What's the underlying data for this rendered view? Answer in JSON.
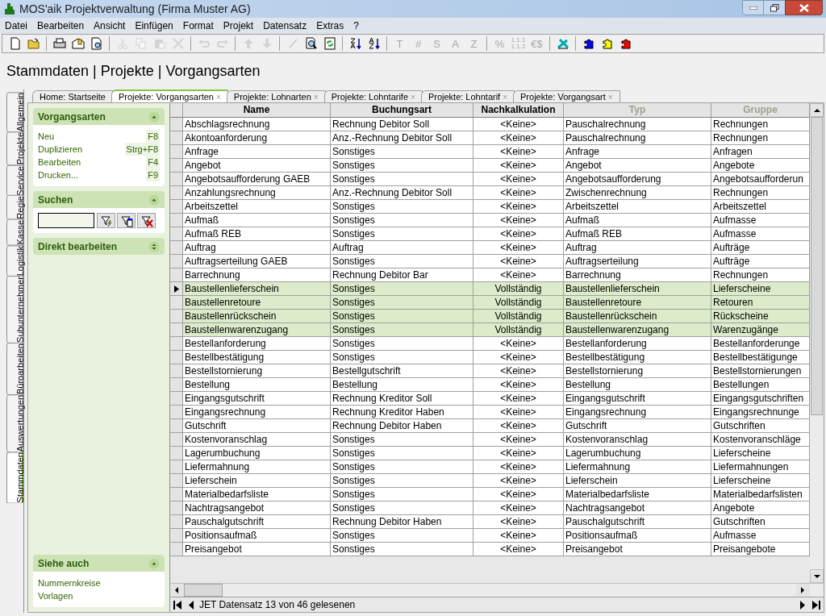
{
  "window": {
    "title": "MOS'aik Projektverwaltung (Firma Muster AG)"
  },
  "menu": [
    "Datei",
    "Bearbeiten",
    "Ansicht",
    "Einfügen",
    "Format",
    "Projekt",
    "Datensatz",
    "Extras",
    "?"
  ],
  "toolbar": [
    [
      {
        "kind": "page",
        "disabled": false
      },
      {
        "kind": "folder",
        "disabled": false
      }
    ],
    [
      {
        "kind": "printer",
        "disabled": false
      },
      {
        "kind": "mail",
        "disabled": false
      },
      {
        "kind": "preview",
        "disabled": false
      }
    ],
    [
      {
        "kind": "cut",
        "disabled": true
      },
      {
        "kind": "copy",
        "disabled": true
      },
      {
        "kind": "paste",
        "disabled": true
      },
      {
        "kind": "delete",
        "disabled": true
      }
    ],
    [
      {
        "kind": "undo",
        "disabled": true
      },
      {
        "kind": "redo",
        "disabled": true
      }
    ],
    [
      {
        "kind": "up",
        "disabled": true
      },
      {
        "kind": "down",
        "disabled": true
      }
    ],
    [
      {
        "kind": "pen",
        "disabled": true
      },
      {
        "kind": "find",
        "disabled": false
      },
      {
        "kind": "refresh",
        "disabled": false
      }
    ],
    [
      {
        "kind": "sort-asc",
        "disabled": false
      },
      {
        "kind": "sort-desc",
        "disabled": false
      }
    ],
    [
      {
        "kind": "text",
        "label": "T",
        "disabled": true
      },
      {
        "kind": "text",
        "label": "#",
        "disabled": true
      },
      {
        "kind": "text",
        "label": "S",
        "disabled": true
      },
      {
        "kind": "text",
        "label": "A",
        "disabled": true
      },
      {
        "kind": "text",
        "label": "Z",
        "disabled": true
      }
    ],
    [
      {
        "kind": "text",
        "label": "%",
        "disabled": true
      },
      {
        "kind": "stack",
        "label": "1.1.1",
        "label2": "1.1.2",
        "disabled": true
      },
      {
        "kind": "text",
        "label": "€$",
        "disabled": true
      }
    ],
    [
      {
        "kind": "tool",
        "disabled": false
      }
    ],
    [
      {
        "kind": "puzzle",
        "color": "#0000ff",
        "disabled": false
      },
      {
        "kind": "puzzle",
        "color": "#ffff00",
        "disabled": false
      },
      {
        "kind": "puzzle",
        "color": "#ff0000",
        "disabled": false
      }
    ]
  ],
  "heading": "Stammdaten | Projekte | Vorgangsarten",
  "side_tabs": [
    {
      "label": "Allgemein",
      "selected": false
    },
    {
      "label": "Projekte",
      "selected": false
    },
    {
      "label": "Service",
      "selected": false
    },
    {
      "label": "Regie",
      "selected": false
    },
    {
      "label": "Kasse",
      "selected": false
    },
    {
      "label": "Logistik",
      "selected": false
    },
    {
      "label": "Subunternehmer",
      "selected": false
    },
    {
      "label": "Büroarbeiten",
      "selected": false
    },
    {
      "label": "Auswertungen",
      "selected": false
    },
    {
      "label": "Stammdaten",
      "selected": true
    }
  ],
  "doc_tabs": [
    {
      "label": "Home: Startseite",
      "selected": false
    },
    {
      "label": "Projekte: Vorgangsarten",
      "close": "×",
      "selected": true
    },
    {
      "label": "Projekte: Lohnarten",
      "close": "×",
      "selected": false
    },
    {
      "label": "Projekte: Lohntarife",
      "close": "×",
      "selected": false
    },
    {
      "label": "Projekte: Lohntarif",
      "close": "×",
      "selected": false
    },
    {
      "label": "Projekte: Vorgangsart",
      "close": "×",
      "selected": false
    }
  ],
  "panel": {
    "sections": [
      {
        "kind": "actions",
        "title": "Vorgangsarten",
        "expanded": true,
        "items": [
          {
            "label": "Neu",
            "shortcut": "F8"
          },
          {
            "label": "Duplizieren",
            "shortcut": "Strg+F8"
          },
          {
            "label": "Bearbeiten",
            "shortcut": "F4"
          },
          {
            "label": "Drucken...",
            "shortcut": "F9"
          }
        ]
      },
      {
        "kind": "search",
        "title": "Suchen",
        "expanded": true
      },
      {
        "title": "Direkt bearbeiten",
        "expanded": false
      }
    ],
    "footer": {
      "kind": "links",
      "title": "Siehe auch",
      "expanded": true,
      "items": [
        {
          "label": "Nummernkreise"
        },
        {
          "label": "Vorlagen"
        }
      ]
    }
  },
  "table": {
    "columns": [
      {
        "label": "Name",
        "disabled": false
      },
      {
        "label": "Buchungsart",
        "disabled": false
      },
      {
        "label": "Nachkalkulation",
        "disabled": false
      },
      {
        "label": "Typ",
        "disabled": true
      },
      {
        "label": "Gruppe",
        "disabled": true
      }
    ],
    "rows": [
      {
        "cells": [
          "Abschlagsrechnung",
          "Rechnung Debitor Soll",
          "<Keine>",
          "Pauschalrechnung",
          "Rechnungen"
        ],
        "selected": false,
        "current": false
      },
      {
        "cells": [
          "Akontoanforderung",
          "Anz.-Rechnung Debitor Soll",
          "<Keine>",
          "Pauschalrechnung",
          "Rechnungen"
        ],
        "selected": false,
        "current": false
      },
      {
        "cells": [
          "Anfrage",
          "Sonstiges",
          "<Keine>",
          "Anfrage",
          "Anfragen"
        ],
        "selected": false,
        "current": false
      },
      {
        "cells": [
          "Angebot",
          "Sonstiges",
          "<Keine>",
          "Angebot",
          "Angebote"
        ],
        "selected": false,
        "current": false
      },
      {
        "cells": [
          "Angebotsaufforderung GAEB",
          "Sonstiges",
          "<Keine>",
          "Angebotsaufforderung",
          "Angebotsaufforderun"
        ],
        "selected": false,
        "current": false
      },
      {
        "cells": [
          "Anzahlungsrechnung",
          "Anz.-Rechnung Debitor Soll",
          "<Keine>",
          "Zwischenrechnung",
          "Rechnungen"
        ],
        "selected": false,
        "current": false
      },
      {
        "cells": [
          "Arbeitszettel",
          "Sonstiges",
          "<Keine>",
          "Arbeitszettel",
          "Arbeitszettel"
        ],
        "selected": false,
        "current": false
      },
      {
        "cells": [
          "Aufmaß",
          "Sonstiges",
          "<Keine>",
          "Aufmaß",
          "Aufmasse"
        ],
        "selected": false,
        "current": false
      },
      {
        "cells": [
          "Aufmaß REB",
          "Sonstiges",
          "<Keine>",
          "Aufmaß REB",
          "Aufmasse"
        ],
        "selected": false,
        "current": false
      },
      {
        "cells": [
          "Auftrag",
          "Auftrag",
          "<Keine>",
          "Auftrag",
          "Aufträge"
        ],
        "selected": false,
        "current": false
      },
      {
        "cells": [
          "Auftragserteilung GAEB",
          "Sonstiges",
          "<Keine>",
          "Auftragserteilung",
          "Aufträge"
        ],
        "selected": false,
        "current": false
      },
      {
        "cells": [
          "Barrechnung",
          "Rechnung Debitor Bar",
          "<Keine>",
          "Barrechnung",
          "Rechnungen"
        ],
        "selected": false,
        "current": false
      },
      {
        "cells": [
          "Baustellenlieferschein",
          "Sonstiges",
          "Vollständig",
          "Baustellenlieferschein",
          "Lieferscheine"
        ],
        "selected": true,
        "current": true
      },
      {
        "cells": [
          "Baustellenretoure",
          "Sonstiges",
          "Vollständig",
          "Baustellenretoure",
          "Retouren"
        ],
        "selected": true,
        "current": false
      },
      {
        "cells": [
          "Baustellenrückschein",
          "Sonstiges",
          "Vollständig",
          "Baustellenrückschein",
          "Rückscheine"
        ],
        "selected": true,
        "current": false
      },
      {
        "cells": [
          "Baustellenwarenzugang",
          "Sonstiges",
          "Vollständig",
          "Baustellenwarenzugang",
          "Warenzugänge"
        ],
        "selected": true,
        "current": false
      },
      {
        "cells": [
          "Bestellanforderung",
          "Sonstiges",
          "<Keine>",
          "Bestellanforderung",
          "Bestellanforderunge"
        ],
        "selected": false,
        "current": false
      },
      {
        "cells": [
          "Bestellbestätigung",
          "Sonstiges",
          "<Keine>",
          "Bestellbestätigung",
          "Bestellbestätigunge"
        ],
        "selected": false,
        "current": false
      },
      {
        "cells": [
          "Bestellstornierung",
          "Bestellgutschrift",
          "<Keine>",
          "Bestellstornierung",
          "Bestellstornierungen"
        ],
        "selected": false,
        "current": false
      },
      {
        "cells": [
          "Bestellung",
          "Bestellung",
          "<Keine>",
          "Bestellung",
          "Bestellungen"
        ],
        "selected": false,
        "current": false
      },
      {
        "cells": [
          "Eingangsgutschrift",
          "Rechnung Kreditor Soll",
          "<Keine>",
          "Eingangsgutschrift",
          "Eingangsgutschriften"
        ],
        "selected": false,
        "current": false
      },
      {
        "cells": [
          "Eingangsrechnung",
          "Rechnung Kreditor Haben",
          "<Keine>",
          "Eingangsrechnung",
          "Eingangsrechnunge"
        ],
        "selected": false,
        "current": false
      },
      {
        "cells": [
          "Gutschrift",
          "Rechnung Debitor Haben",
          "<Keine>",
          "Gutschrift",
          "Gutschriften"
        ],
        "selected": false,
        "current": false
      },
      {
        "cells": [
          "Kostenvoranschlag",
          "Sonstiges",
          "<Keine>",
          "Kostenvoranschlag",
          "Kostenvoranschläge"
        ],
        "selected": false,
        "current": false
      },
      {
        "cells": [
          "Lagerumbuchung",
          "Sonstiges",
          "<Keine>",
          "Lagerumbuchung",
          "Lieferscheine"
        ],
        "selected": false,
        "current": false
      },
      {
        "cells": [
          "Liefermahnung",
          "Sonstiges",
          "<Keine>",
          "Liefermahnung",
          "Liefermahnungen"
        ],
        "selected": false,
        "current": false
      },
      {
        "cells": [
          "Lieferschein",
          "Sonstiges",
          "<Keine>",
          "Lieferschein",
          "Lieferscheine"
        ],
        "selected": false,
        "current": false
      },
      {
        "cells": [
          "Materialbedarfsliste",
          "Sonstiges",
          "<Keine>",
          "Materialbedarfsliste",
          "Materialbedarfslisten"
        ],
        "selected": false,
        "current": false
      },
      {
        "cells": [
          "Nachtragsangebot",
          "Sonstiges",
          "<Keine>",
          "Nachtragsangebot",
          "Angebote"
        ],
        "selected": false,
        "current": false
      },
      {
        "cells": [
          "Pauschalgutschrift",
          "Rechnung Debitor Haben",
          "<Keine>",
          "Pauschalgutschrift",
          "Gutschriften"
        ],
        "selected": false,
        "current": false
      },
      {
        "cells": [
          "Positionsaufmaß",
          "Sonstiges",
          "<Keine>",
          "Positionsaufmaß",
          "Aufmasse"
        ],
        "selected": false,
        "current": false
      },
      {
        "cells": [
          "Preisangebot",
          "Sonstiges",
          "<Keine>",
          "Preisangebot",
          "Preisangebote"
        ],
        "selected": false,
        "current": false
      }
    ]
  },
  "status_bar": {
    "text": "JET Datensatz 13 von 46 gelesenen"
  }
}
